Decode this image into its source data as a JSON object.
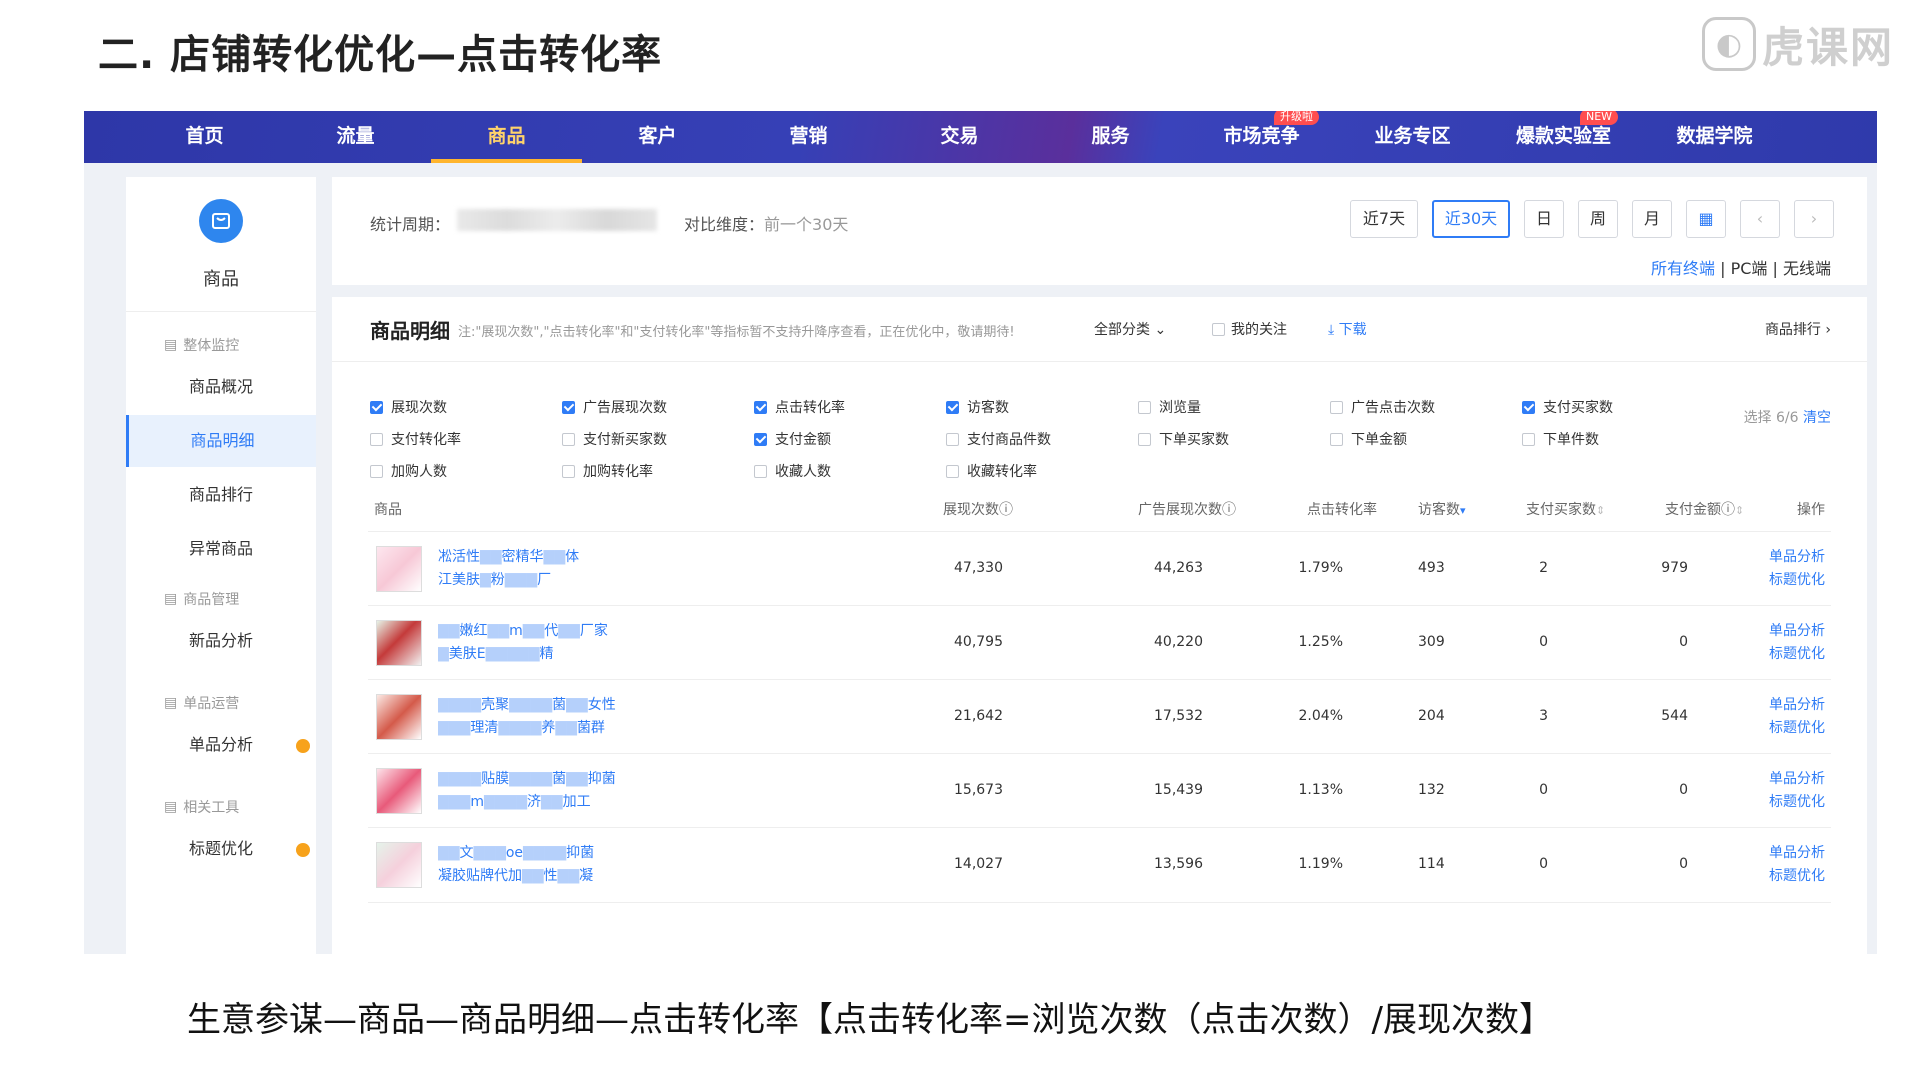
{
  "slide": {
    "title": "二. 店铺转化优化—点击转化率",
    "caption": "生意参谋—商品—商品明细—点击转化率【点击转化率=浏览次数（点击次数）/展现次数】",
    "watermark": "虎课网"
  },
  "topnav": {
    "items": [
      {
        "label": "首页"
      },
      {
        "label": "流量"
      },
      {
        "label": "商品",
        "active": true
      },
      {
        "label": "客户"
      },
      {
        "label": "营销"
      },
      {
        "label": "交易"
      },
      {
        "label": "服务"
      },
      {
        "label": "市场竞争",
        "badge": "升级啦"
      },
      {
        "label": "业务专区"
      },
      {
        "label": "爆款实验室",
        "badge": "NEW"
      },
      {
        "label": "数据学院"
      }
    ],
    "colors": {
      "bg": "#2f3aab",
      "active": "#ffd36b",
      "underline": "#ffb52e"
    }
  },
  "sidebar": {
    "app_label": "商品",
    "groups": [
      {
        "label": "整体监控",
        "items": [
          {
            "label": "商品概况"
          },
          {
            "label": "商品明细",
            "active": true
          },
          {
            "label": "商品排行"
          },
          {
            "label": "异常商品"
          }
        ]
      },
      {
        "label": "商品管理",
        "items": [
          {
            "label": "新品分析"
          }
        ]
      },
      {
        "label": "单品运营",
        "items": [
          {
            "label": "单品分析",
            "dot": true
          }
        ]
      },
      {
        "label": "相关工具",
        "items": [
          {
            "label": "标题优化",
            "dot": true
          }
        ]
      }
    ]
  },
  "period": {
    "label": "统计周期：",
    "compare_label": "对比维度：",
    "compare_value": "前一个30天",
    "buttons": [
      "近7天",
      "近30天",
      "日",
      "周",
      "月"
    ],
    "active_button": "近30天",
    "terminals": {
      "all": "所有终端",
      "pc": "PC端",
      "wireless": "无线端",
      "sep": "|"
    }
  },
  "detail": {
    "title": "商品明细",
    "note": "注:\"展现次数\",\"点击转化率\"和\"支付转化率\"等指标暂不支持升降序查看，正在优化中，敬请期待!",
    "category": "全部分类",
    "follow": "我的关注",
    "download": "下载",
    "rank": "商品排行",
    "select_count": "选择 6/6",
    "clear": "清空",
    "metrics": [
      [
        {
          "label": "展现次数",
          "checked": true
        },
        {
          "label": "广告展现次数",
          "checked": true
        },
        {
          "label": "点击转化率",
          "checked": true
        },
        {
          "label": "访客数",
          "checked": true
        },
        {
          "label": "浏览量",
          "checked": false
        },
        {
          "label": "广告点击次数",
          "checked": false
        },
        {
          "label": "支付买家数",
          "checked": true
        }
      ],
      [
        {
          "label": "支付转化率",
          "checked": false
        },
        {
          "label": "支付新买家数",
          "checked": false
        },
        {
          "label": "支付金额",
          "checked": true
        },
        {
          "label": "支付商品件数",
          "checked": false
        },
        {
          "label": "下单买家数",
          "checked": false
        },
        {
          "label": "下单金额",
          "checked": false
        },
        {
          "label": "下单件数",
          "checked": false
        }
      ],
      [
        {
          "label": "加购人数",
          "checked": false
        },
        {
          "label": "加购转化率",
          "checked": false
        },
        {
          "label": "收藏人数",
          "checked": false
        },
        {
          "label": "收藏转化率",
          "checked": false
        }
      ]
    ],
    "table": {
      "columns": [
        "商品",
        "展现次数",
        "广告展现次数",
        "点击转化率",
        "访客数",
        "支付买家数",
        "支付金额",
        "操作"
      ],
      "ops": {
        "analysis": "单品分析",
        "title_opt": "标题优化"
      },
      "rows": [
        {
          "name1": "凇活性",
          "name2": "密精华",
          "name3": "体",
          "name4": "江美肤",
          "name5": "粉",
          "name6": "厂",
          "impressions": "47,330",
          "ad_impressions": "44,263",
          "ctr": "1.79%",
          "visitors": "493",
          "buyers": "2",
          "amount": "979"
        },
        {
          "name1": "嫩红",
          "name2": "m",
          "name3": "代",
          "name4": "厂家",
          "name5": "美肤E",
          "name6": "精",
          "impressions": "40,795",
          "ad_impressions": "40,220",
          "ctr": "1.25%",
          "visitors": "309",
          "buyers": "0",
          "amount": "0"
        },
        {
          "name1": "壳聚",
          "name2": "菌",
          "name3": "女性",
          "name4": "理清",
          "name5": "养",
          "name6": "菌群",
          "impressions": "21,642",
          "ad_impressions": "17,532",
          "ctr": "2.04%",
          "visitors": "204",
          "buyers": "3",
          "amount": "544"
        },
        {
          "name1": "贴膜",
          "name2": "菌",
          "name3": "抑菌",
          "name4": "m",
          "name5": "济",
          "name6": "加工",
          "impressions": "15,673",
          "ad_impressions": "15,439",
          "ctr": "1.13%",
          "visitors": "132",
          "buyers": "0",
          "amount": "0"
        },
        {
          "name1": "文",
          "name2": "oe",
          "name3": "抑菌",
          "name4": "凝胶贴牌代加",
          "name5": "性",
          "name6": "凝",
          "impressions": "14,027",
          "ad_impressions": "13,596",
          "ctr": "1.19%",
          "visitors": "114",
          "buyers": "0",
          "amount": "0"
        }
      ]
    }
  }
}
